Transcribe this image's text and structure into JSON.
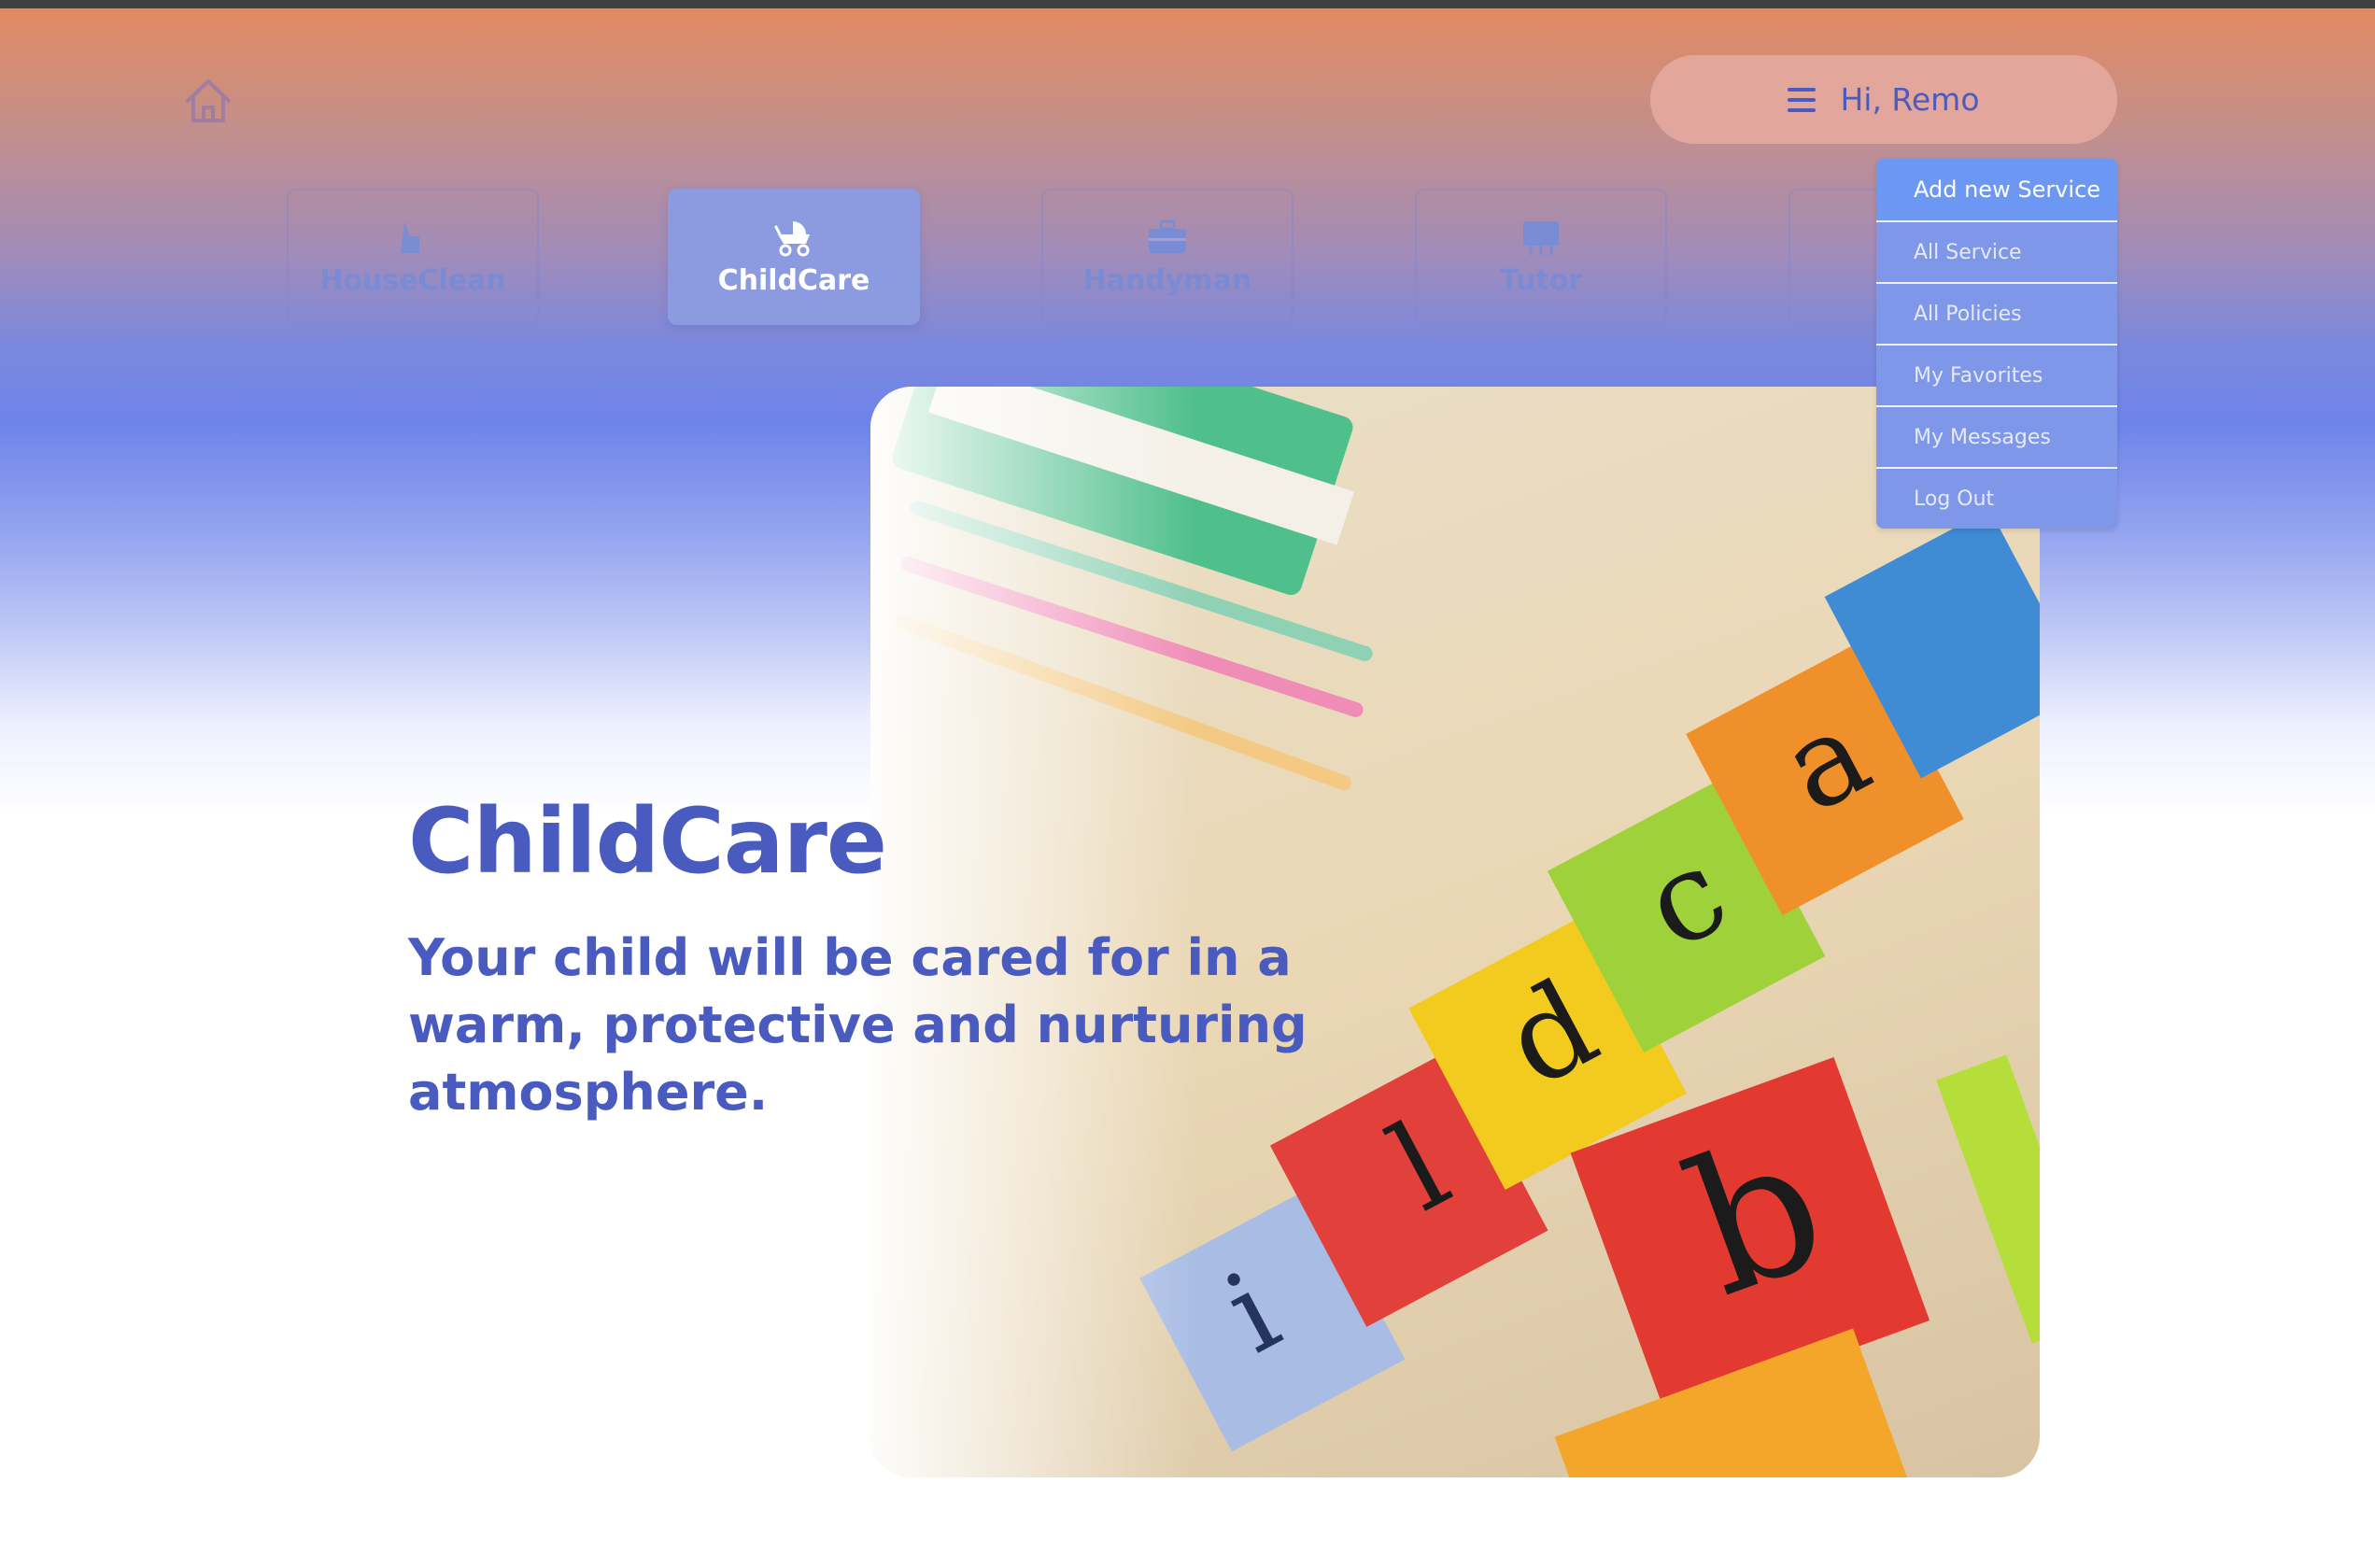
{
  "header": {
    "home_icon": "home-icon",
    "user_greeting": "Hi, Remo",
    "menu_icon": "hamburger-icon"
  },
  "categories": [
    {
      "label": "HouseClean",
      "icon": "broom-icon",
      "active": false
    },
    {
      "label": "ChildCare",
      "icon": "stroller-icon",
      "active": true
    },
    {
      "label": "Handyman",
      "icon": "toolbox-icon",
      "active": false
    },
    {
      "label": "Tutor",
      "icon": "chalkboard-icon",
      "active": false
    }
  ],
  "dropdown": {
    "items": [
      "Add new Service",
      "All Service",
      "All Policies",
      "My Favorites",
      "My Messages",
      "Log Out"
    ]
  },
  "hero": {
    "title": "ChildCare",
    "subtitle": "Your child will be cared for in a warm, protective and nurturing atmosphere.",
    "image": "alphabet-blocks-photo"
  },
  "colors": {
    "brand_blue": "#4a5bc0",
    "active_tab": "#8c9be0",
    "dropdown_bg": "#7f97e8",
    "dropdown_highlight": "#6c98f4",
    "gradient_top": "#e48a5e",
    "gradient_mid": "#6e84ea"
  }
}
